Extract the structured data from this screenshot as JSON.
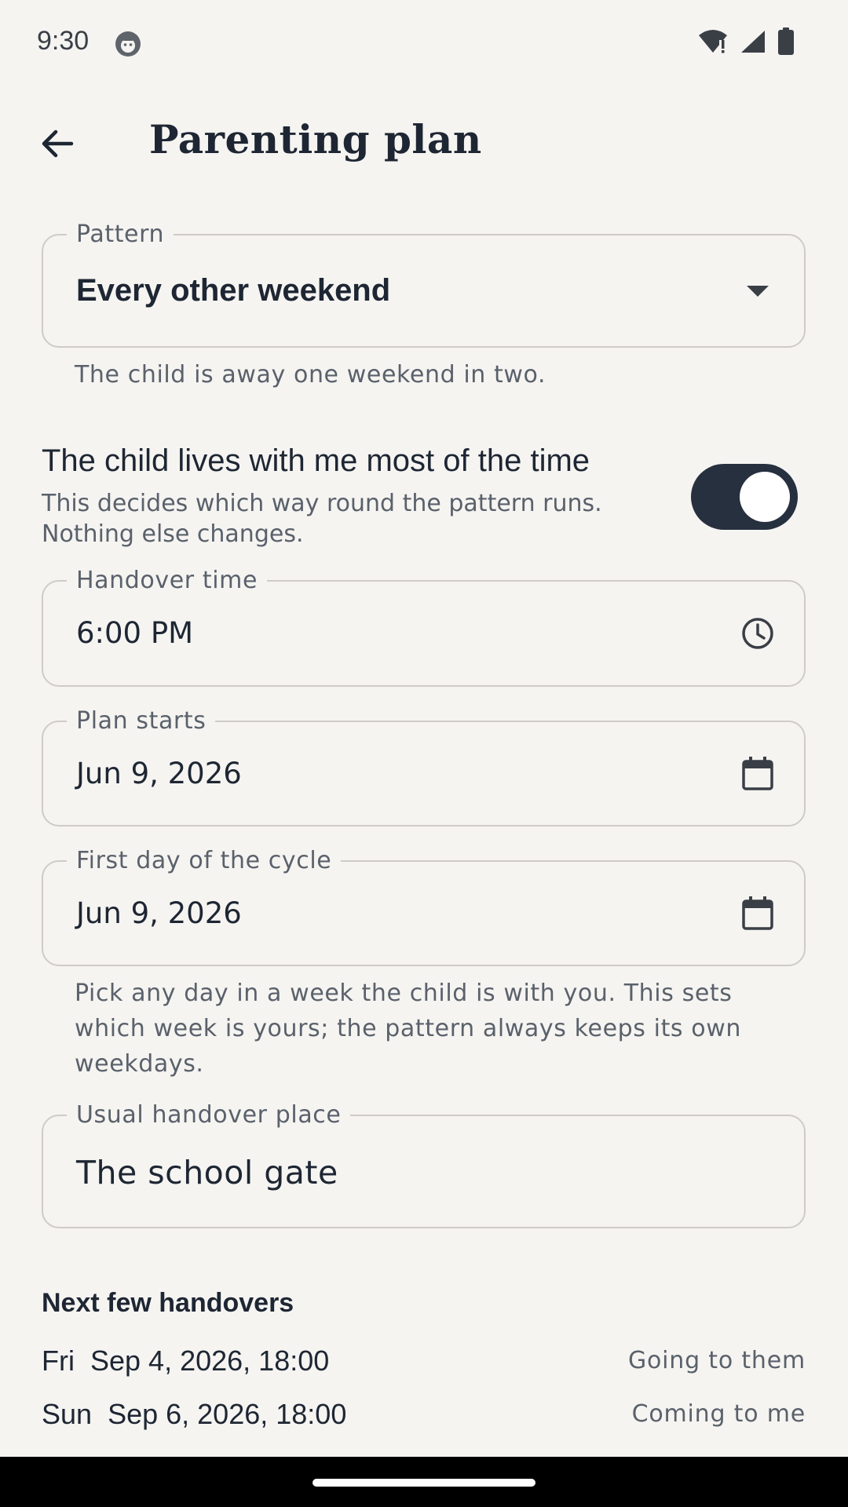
{
  "status_bar": {
    "time": "9:30"
  },
  "app_bar": {
    "title": "Parenting plan"
  },
  "pattern": {
    "label": "Pattern",
    "value": "Every other weekend",
    "helper": "The child is away one weekend in two."
  },
  "main_carer": {
    "title": "The child lives with me most of the time",
    "description": "This decides which way round the pattern runs. Nothing else changes.",
    "enabled": true
  },
  "handover_time": {
    "label": "Handover time",
    "value": "6:00 PM"
  },
  "plan_starts": {
    "label": "Plan starts",
    "value": "Jun 9, 2026"
  },
  "cycle_start": {
    "label": "First day of the cycle",
    "value": "Jun 9, 2026",
    "helper": "Pick any day in a week the child is with you. This sets which week is yours; the pattern always keeps its own weekdays."
  },
  "handover_place": {
    "label": "Usual handover place",
    "value": "The school gate"
  },
  "upcoming": {
    "title": "Next few handovers",
    "items": [
      {
        "day": "Fri",
        "datetime": "Sep 4, 2026, 18:00",
        "direction": "Going to them"
      },
      {
        "day": "Sun",
        "datetime": "Sep 6, 2026, 18:00",
        "direction": "Coming to me"
      }
    ]
  },
  "colors": {
    "accent": "#26303f",
    "background": "#f5f4f1",
    "outline": "#cfccc7"
  }
}
